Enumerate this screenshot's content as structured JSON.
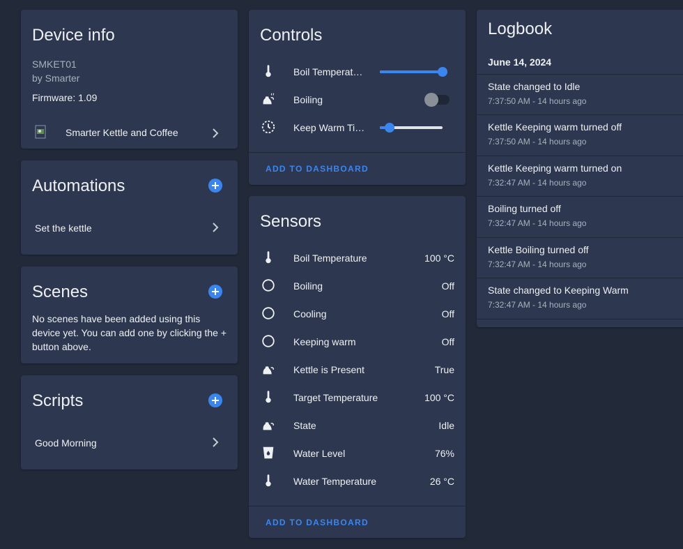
{
  "device_info": {
    "title": "Device info",
    "model": "SMKET01",
    "manufacturer": "by Smarter",
    "firmware": "Firmware: 1.09",
    "integration_label": "Smarter Kettle and Coffee"
  },
  "automations": {
    "title": "Automations",
    "items": [
      {
        "label": "Set the kettle"
      }
    ]
  },
  "scenes": {
    "title": "Scenes",
    "empty_text": "No scenes have been added using this device yet. You can add one by clicking the + button above."
  },
  "scripts": {
    "title": "Scripts",
    "items": [
      {
        "label": "Good Morning"
      }
    ]
  },
  "controls": {
    "title": "Controls",
    "items": [
      {
        "label": "Boil Temperat…",
        "icon": "thermometer-icon",
        "type": "slider",
        "level": 1.0
      },
      {
        "label": "Boiling",
        "icon": "kettle-steam-icon",
        "type": "toggle",
        "on": false
      },
      {
        "label": "Keep Warm Ti…",
        "icon": "timer-icon",
        "type": "slider",
        "level": 0.15
      }
    ],
    "action": "ADD TO DASHBOARD"
  },
  "sensors": {
    "title": "Sensors",
    "items": [
      {
        "label": "Boil Temperature",
        "value": "100 °C",
        "icon": "thermometer-icon"
      },
      {
        "label": "Boiling",
        "value": "Off",
        "icon": "circle-outline-icon"
      },
      {
        "label": "Cooling",
        "value": "Off",
        "icon": "circle-outline-icon"
      },
      {
        "label": "Keeping warm",
        "value": "Off",
        "icon": "circle-outline-icon"
      },
      {
        "label": "Kettle is Present",
        "value": "True",
        "icon": "kettle-icon"
      },
      {
        "label": "Target Temperature",
        "value": "100 °C",
        "icon": "thermometer-icon"
      },
      {
        "label": "State",
        "value": "Idle",
        "icon": "kettle-icon"
      },
      {
        "label": "Water Level",
        "value": "76%",
        "icon": "cup-water-icon"
      },
      {
        "label": "Water Temperature",
        "value": "26 °C",
        "icon": "thermometer-icon"
      }
    ],
    "action": "ADD TO DASHBOARD"
  },
  "logbook": {
    "title": "Logbook",
    "date": "June 14, 2024",
    "entries": [
      {
        "text": "State changed to Idle",
        "time": "7:37:50 AM - 14 hours ago"
      },
      {
        "text": "Kettle Keeping warm turned off",
        "time": "7:37:50 AM - 14 hours ago"
      },
      {
        "text": "Kettle Keeping warm turned on",
        "time": "7:32:47 AM - 14 hours ago"
      },
      {
        "text": "Boiling turned off",
        "time": "7:32:47 AM - 14 hours ago"
      },
      {
        "text": "Kettle Boiling turned off",
        "time": "7:32:47 AM - 14 hours ago"
      },
      {
        "text": "State changed to Keeping Warm",
        "time": "7:32:47 AM - 14 hours ago"
      }
    ]
  },
  "colors": {
    "background": "#222a3a",
    "card": "#2d3850",
    "accent": "#3a86f0",
    "text": "#eef0f4",
    "secondary_text": "#a9b0bd"
  }
}
